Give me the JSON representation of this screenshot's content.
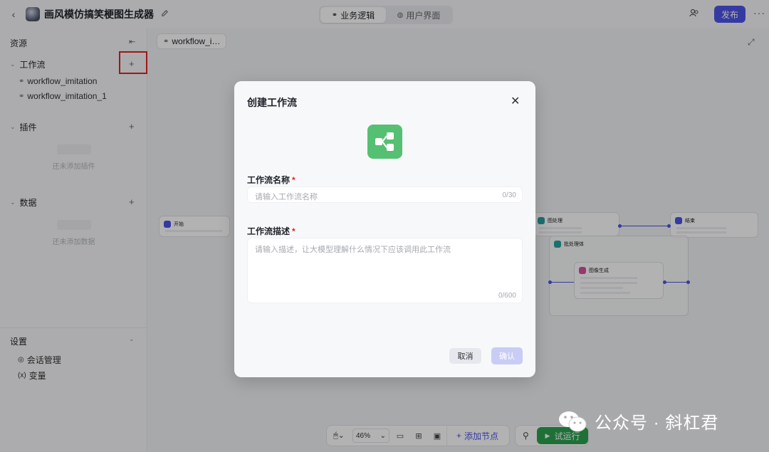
{
  "topbar": {
    "app_title": "画风模仿搞笑梗图生成器",
    "tabs": [
      {
        "label": "业务逻辑",
        "active": true
      },
      {
        "label": "用户界面",
        "active": false
      }
    ],
    "publish_label": "发布"
  },
  "sidebar": {
    "title": "资源",
    "workflow_section": {
      "label": "工作流",
      "items": [
        "workflow_imitation",
        "workflow_imitation_1"
      ]
    },
    "plugin_section": {
      "label": "插件",
      "empty_text": "还未添加插件"
    },
    "data_section": {
      "label": "数据",
      "empty_text": "还未添加数据"
    },
    "settings": {
      "label": "设置",
      "items": [
        {
          "icon": "chat-manage-icon",
          "label": "会话管理"
        },
        {
          "icon": "variable-icon",
          "label": "变量"
        }
      ]
    }
  },
  "canvas": {
    "tab_label": "workflow_i…",
    "nodes": {
      "start": {
        "title": "开始"
      },
      "process": {
        "title": "图处理"
      },
      "end": {
        "title": "结束"
      },
      "loop": {
        "title": "批处理体"
      },
      "image_gen": {
        "title": "图像生成"
      }
    },
    "toolbar": {
      "zoom": "46%",
      "add_node_label": "添加节点",
      "run_label": "试运行"
    }
  },
  "modal": {
    "title": "创建工作流",
    "name_label": "工作流名称",
    "name_placeholder": "请输入工作流名称",
    "name_count": "0/30",
    "desc_label": "工作流描述",
    "desc_placeholder": "请输入描述，让大模型理解什么情况下应该调用此工作流",
    "desc_count": "0/600",
    "cancel_label": "取消",
    "confirm_label": "确认",
    "required_mark": "*"
  },
  "watermark": {
    "text": "公众号 · 斜杠君"
  },
  "colors": {
    "accent": "#4d53e8",
    "run_green": "#2ca14f",
    "workflow_logo": "#55c072",
    "required": "#e5211f"
  }
}
